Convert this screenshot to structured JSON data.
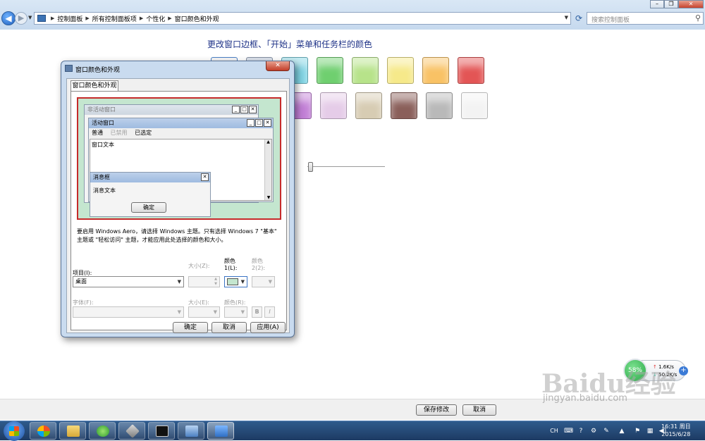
{
  "address": {
    "breadcrumbs": [
      "控制面板",
      "所有控制面板项",
      "个性化",
      "窗口颜色和外观"
    ],
    "search_placeholder": "搜索控制面板"
  },
  "main": {
    "heading": "更改窗口边框、「开始」菜单和任务栏的颜色",
    "swatch_colors_row1": [
      "#eeeeee",
      "#b0bfd6",
      "#7fd3e3",
      "#6fcf6f",
      "#b7e38a",
      "#f6e98a",
      "#f9c265",
      "#e35555"
    ],
    "swatch_colors_row2": [
      "#c27fd6",
      "#e5cce8",
      "#d7ccb3",
      "#8a5f5a",
      "#b9b9b9",
      "#f3f3f3"
    ],
    "save_label": "保存修改",
    "cancel_label": "取消"
  },
  "dialog": {
    "title": "窗口颜色和外观",
    "tab_label": "窗口颜色和外观",
    "preview": {
      "inactive_title": "非活动窗口",
      "active_title": "活动窗口",
      "menu_normal": "普通",
      "menu_disabled": "已禁用",
      "menu_selected": "已选定",
      "window_text": "窗口文本",
      "msgbox_title": "消息框",
      "msgbox_text": "消息文本",
      "msgbox_ok": "确定"
    },
    "info_text": "要启用 Windows Aero，请选择 Windows 主题。只有选择 Windows 7 \"基本\" 主题或 \"轻松访问\" 主题，才能应用此处选择的颜色和大小。",
    "item_label": "项目(I):",
    "item_value": "桌面",
    "size_label": "大小(Z):",
    "color1_label": "颜色 1(L):",
    "color2_label": "颜色 2(2):",
    "color1_value": "#c4e6cf",
    "font_label": "字体(F):",
    "font_size_label": "大小(E):",
    "font_color_label": "颜色(R):",
    "bold_label": "B",
    "italic_label": "I",
    "ok_label": "确定",
    "cancel_label": "取消",
    "apply_label": "应用(A)"
  },
  "net_widget": {
    "percent": "58%",
    "up": "1.6K/s",
    "down": "50.2K/s"
  },
  "watermark": {
    "logo_text": "Baidu经验",
    "url": "jingyan.baidu.com"
  },
  "taskbar": {
    "lang": "CH",
    "time": "16:31 周日",
    "date": "2015/6/28"
  }
}
